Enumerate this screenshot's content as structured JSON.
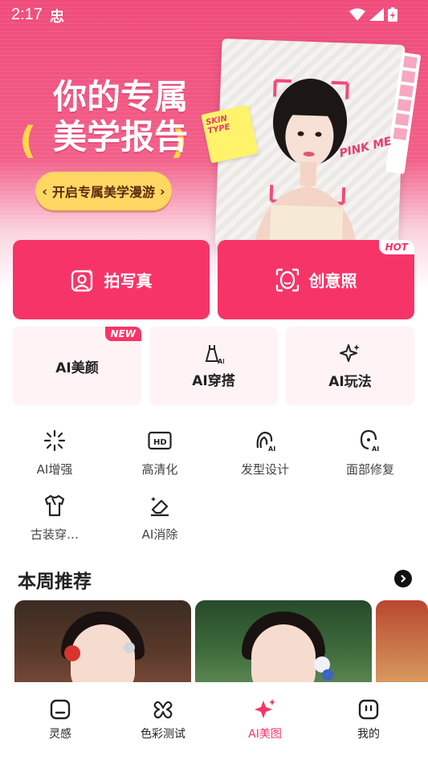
{
  "status_bar": {
    "time": "2:17",
    "app_glyph": "忠"
  },
  "hero": {
    "title_line1": "你的专属",
    "title_line2": "美学报告",
    "cta": "开启专属美学漫游",
    "sticker_text": "SKIN TYPE",
    "pink_text": "PINK ME"
  },
  "actions": [
    {
      "label": "拍写真",
      "icon": "portrait-camera-icon"
    },
    {
      "label": "创意照",
      "icon": "face-frame-icon",
      "tag": "HOT"
    }
  ],
  "ai_cards": [
    {
      "label": "AI美颜",
      "tag": "NEW"
    },
    {
      "label": "AI穿搭",
      "icon": "dress-ai-icon"
    },
    {
      "label": "AI玩法",
      "icon": "sparkle-icon"
    }
  ],
  "tools": [
    {
      "label": "AI增强",
      "icon": "enhance-icon"
    },
    {
      "label": "高清化",
      "icon": "hd-icon"
    },
    {
      "label": "发型设计",
      "icon": "hairstyle-ai-icon"
    },
    {
      "label": "面部修复",
      "icon": "face-repair-icon"
    },
    {
      "label": "古装穿…",
      "icon": "costume-icon"
    },
    {
      "label": "AI消除",
      "icon": "eraser-icon"
    }
  ],
  "weekly": {
    "title": "本周推荐"
  },
  "bottom_nav": [
    {
      "label": "灵感",
      "icon": "inspiration-icon",
      "active": false
    },
    {
      "label": "色彩测试",
      "icon": "color-test-icon",
      "active": false
    },
    {
      "label": "AI美图",
      "icon": "ai-sparkle-icon",
      "active": true
    },
    {
      "label": "我的",
      "icon": "profile-icon",
      "active": false
    }
  ],
  "colors": {
    "brand": "#f73467",
    "cta_yellow": "#ffd763",
    "card_bg": "#fff3f6"
  }
}
